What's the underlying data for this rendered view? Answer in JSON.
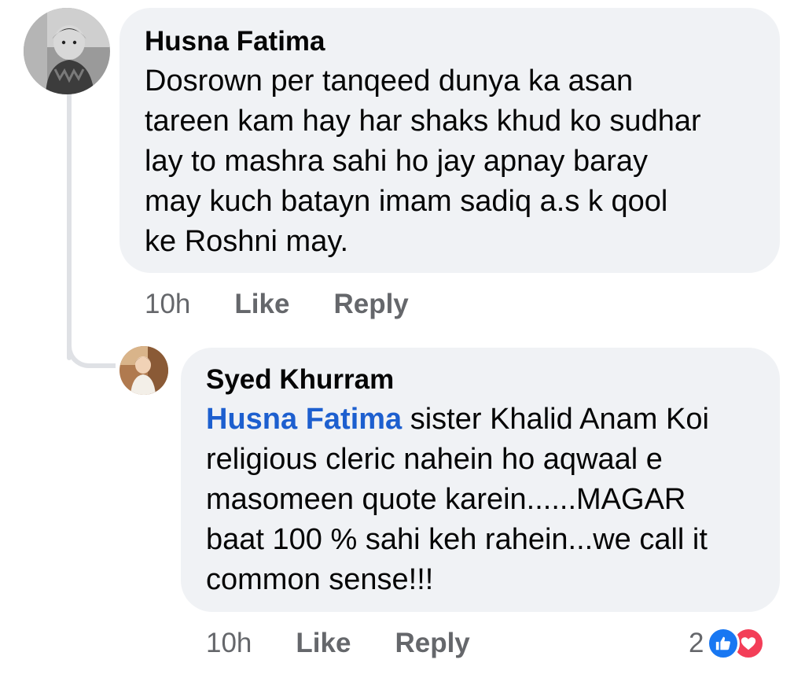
{
  "thread": {
    "comment": {
      "author": "Husna Fatima",
      "text": "Dosrown per tanqeed dunya ka asan\ntareen kam hay har shaks khud ko sudhar\nlay to mashra sahi ho jay apnay baray\nmay kuch batayn imam sadiq a.s k qool\nke Roshni may.",
      "time": "10h",
      "like_label": "Like",
      "reply_label": "Reply"
    },
    "reply": {
      "author": "Syed Khurram",
      "mention": "Husna Fatima",
      "text_first_line_rest": " sister Khalid Anam Koi",
      "text": "religious cleric nahein ho aqwaal e\nmasomeen quote karein......MAGAR\nbaat 100 % sahi keh rahein...we call it\ncommon sense!!!",
      "time": "10h",
      "like_label": "Like",
      "reply_label": "Reply",
      "reaction_count": "2",
      "reaction_icons": [
        "like-icon",
        "love-icon"
      ]
    }
  },
  "colors": {
    "bubble": "#f0f2f5",
    "mention": "#1d5fcf",
    "meta_text": "#65676b",
    "like_reaction": "#1877f2",
    "love_reaction": "#f33e58"
  }
}
